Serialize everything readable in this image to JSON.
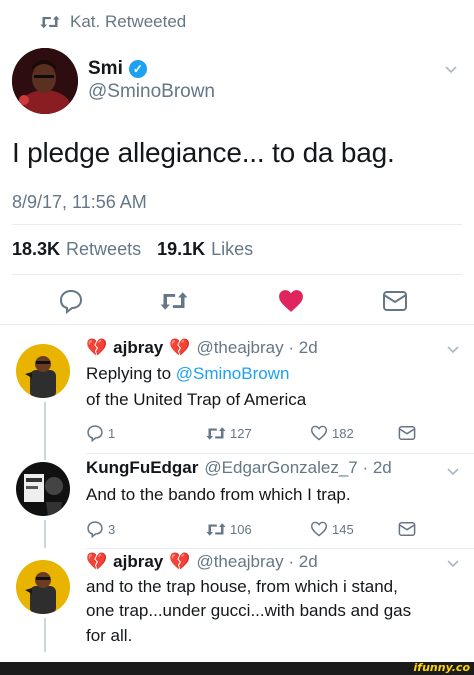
{
  "retweet_header": {
    "text": "Kat. Retweeted"
  },
  "main_tweet": {
    "display_name": "Smi",
    "handle": "@SminoBrown",
    "text": "I pledge allegiance... to da bag.",
    "timestamp": "8/9/17, 11:56 AM",
    "retweets_count": "18.3K",
    "retweets_label": "Retweets",
    "likes_count": "19.1K",
    "likes_label": "Likes"
  },
  "replies": [
    {
      "display_name": "ajbray",
      "handle_meta": "@theajbray · 2d",
      "replying_prefix": "Replying to ",
      "replying_to": "@SminoBrown",
      "lines": [
        "of the United Trap of America"
      ],
      "replies": "1",
      "retweets": "127",
      "likes": "182"
    },
    {
      "display_name": "KungFuEdgar",
      "handle_meta": "@EdgarGonzalez_7 · 2d",
      "lines": [
        "And to the bando from which I trap."
      ],
      "replies": "3",
      "retweets": "106",
      "likes": "145"
    },
    {
      "display_name": "ajbray",
      "handle_meta": "@theajbray · 2d",
      "lines": [
        "and to the trap house, from which i stand,",
        "one trap...under gucci...with bands and gas",
        "for all."
      ]
    }
  ],
  "watermark": "ifunny.co",
  "colors": {
    "accent": "#1da1f2",
    "like_active": "#e0245e",
    "muted": "#657786",
    "broken_heart": "#c4162a"
  }
}
